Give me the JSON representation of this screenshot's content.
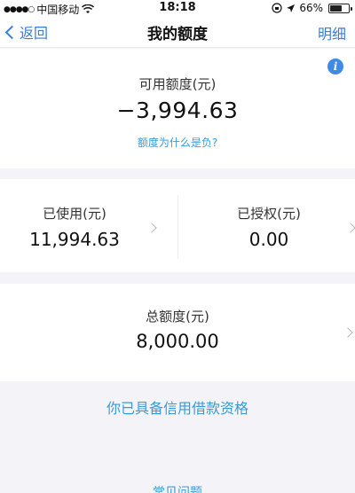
{
  "status_bar": {
    "carrier": "中国移动",
    "signal": "●●●●○",
    "wifi_icon": "wifi-icon",
    "time": "18:18",
    "lock_icon": "orientation-lock-icon",
    "location_icon": "location-arrow-icon",
    "battery_percent": "66%",
    "battery_level": 0.66
  },
  "nav": {
    "back_label": "返回",
    "title": "我的额度",
    "detail_label": "明细"
  },
  "available": {
    "info_icon_glyph": "i",
    "label": "可用额度(元)",
    "value": "−3,994.63",
    "why_negative_link": "额度为什么是负?"
  },
  "used": {
    "label": "已使用(元)",
    "value": "11,994.63"
  },
  "authorized": {
    "label": "已授权(元)",
    "value": "0.00"
  },
  "total": {
    "label": "总额度(元)",
    "value": "8,000.00"
  },
  "eligibility_link": "你已具备信用借款资格",
  "faq_link": "常见问题",
  "colors": {
    "accent": "#3a7ddb",
    "link": "#3a9ad9",
    "info_badge": "#3d8be6",
    "background": "#f4f4f8"
  }
}
